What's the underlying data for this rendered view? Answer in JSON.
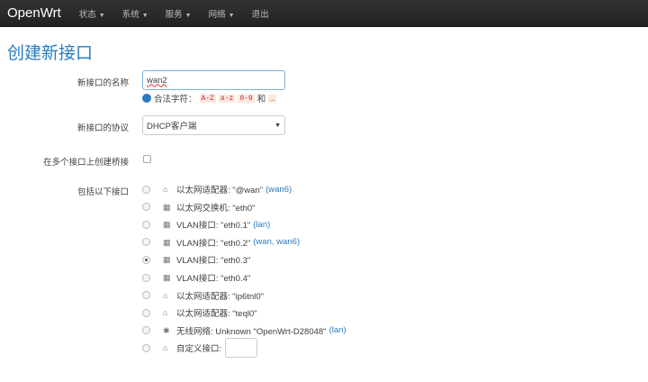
{
  "nav": {
    "brand": "OpenWrt",
    "menus": [
      "状态",
      "系统",
      "服务",
      "网络"
    ],
    "logout": "退出"
  },
  "title": "创建新接口",
  "name_label": "新接口的名称",
  "name_value": "wan2",
  "hint": {
    "text": "合法字符：",
    "codes": [
      "A-Z",
      "a-z",
      "0-9"
    ],
    "and": "和",
    "last": "_"
  },
  "proto_label": "新接口的协议",
  "proto_value": "DHCP客户端",
  "bridge_label": "在多个接口上创建桥接",
  "include_label": "包括以下接口",
  "interfaces": [
    {
      "icon": "ethernet-icon",
      "text": "以太网适配器: \"@wan\"",
      "link": "(wan6)",
      "checked": false
    },
    {
      "icon": "switch-icon",
      "text": "以太网交换机: \"eth0\"",
      "link": "",
      "checked": false
    },
    {
      "icon": "switch-icon",
      "text": "VLAN接口: \"eth0.1\"",
      "link": "(lan)",
      "checked": false
    },
    {
      "icon": "switch-icon",
      "text": "VLAN接口: \"eth0.2\"",
      "link": "(wan, wan6)",
      "checked": false
    },
    {
      "icon": "switch-icon",
      "text": "VLAN接口: \"eth0.3\"",
      "link": "",
      "checked": true
    },
    {
      "icon": "switch-icon",
      "text": "VLAN接口: \"eth0.4\"",
      "link": "",
      "checked": false
    },
    {
      "icon": "ethernet-icon",
      "text": "以太网适配器: \"ip6tnl0\"",
      "link": "",
      "checked": false
    },
    {
      "icon": "ethernet-icon",
      "text": "以太网适配器: \"teql0\"",
      "link": "",
      "checked": false
    },
    {
      "icon": "wifi-icon",
      "text": "无线网络: Unknown \"OpenWrt-D28048\"",
      "link": "(lan)",
      "checked": false
    },
    {
      "icon": "ethernet-icon",
      "text": "自定义接口:",
      "link": "",
      "checked": false
    }
  ]
}
